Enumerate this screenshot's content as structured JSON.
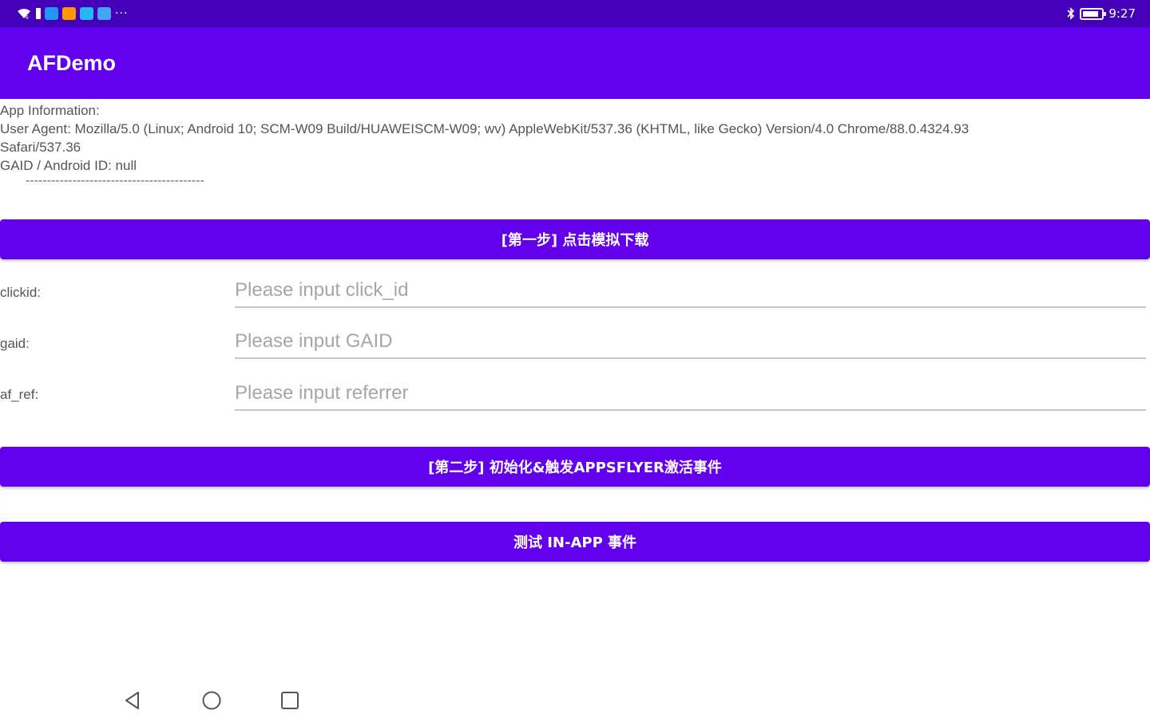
{
  "status_bar": {
    "time": "9:27",
    "left_icons": [
      "wifi-icon",
      "sim-icon",
      "app-notification-icon",
      "app-notification-icon",
      "app-notification-icon",
      "app-notification-icon"
    ],
    "overflow": "···",
    "battery_level": 0.85,
    "colors": {
      "background": "#4400b8",
      "notif_1": "#2196f3",
      "notif_2": "#ff9800",
      "notif_3": "#29b6f6",
      "notif_4": "#42a5f5"
    }
  },
  "app_bar": {
    "title": "AFDemo",
    "color": "#6200ee"
  },
  "app_info": {
    "heading": "App Information:",
    "user_agent_line1": "User Agent: Mozilla/5.0 (Linux; Android 10; SCM-W09 Build/HUAWEISCM-W09; wv) AppleWebKit/537.36 (KHTML, like Gecko) Version/4.0 Chrome/88.0.4324.93",
    "user_agent_line2": "Safari/537.36",
    "gaid_line": "GAID / Android ID: null",
    "divider": "------------------------------------------"
  },
  "buttons": {
    "step1": "[第一步] 点击模拟下载",
    "step2": "[第二步] 初始化&触发APPSFLYER激活事件",
    "test_inapp": "测试 IN-APP 事件"
  },
  "form": {
    "clickid": {
      "label": "clickid:",
      "value": "",
      "placeholder": "Please input click_id"
    },
    "gaid": {
      "label": "gaid:",
      "value": "",
      "placeholder": "Please input GAID"
    },
    "af_ref": {
      "label": "af_ref:",
      "value": "",
      "placeholder": "Please input referrer"
    }
  },
  "nav_bar": {
    "icons": [
      "back-icon",
      "home-icon",
      "recents-icon"
    ]
  }
}
